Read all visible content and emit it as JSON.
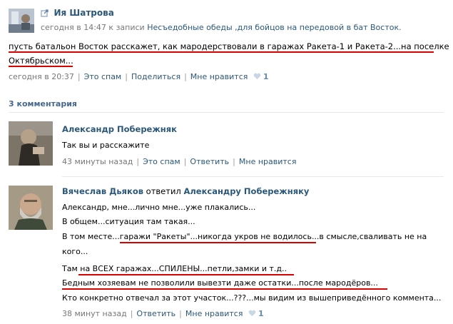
{
  "post": {
    "author": "Ия Шатрова",
    "meta_time": "сегодня в 14:47",
    "meta_mid": "к записи",
    "meta_link": "Несъедобные обеды ,для бойцов на передовой в бат Восток.",
    "text_line1": "пусть батальон Восток расскажет, как мародерствовали в гаражах Ракета-1 и Ракета-2...на поселке",
    "text_line2": "Октябрьском...",
    "footer": {
      "time": "сегодня в 20:37",
      "spam": "Это спам",
      "share": "Поделиться",
      "like": "Мне нравится",
      "like_count": "1"
    }
  },
  "comments_header": "3 комментария",
  "comments": [
    {
      "author": "Александр Побережняк",
      "text": "Так вы и расскажите",
      "time": "43 минуты назад",
      "spam": "Это спам",
      "reply": "Ответить",
      "like": "Мне нравится"
    },
    {
      "author": "Вячеслав Дьяков",
      "replied": "ответил",
      "reply_to": "Александру Побережняку",
      "lines": [
        "Александр, мне...лично мне...уже плакались...",
        "В общем...ситуация там такая...",
        "В том месте...гаражи \"Ракеты\"...никогда укров не водилось...в смысле,сваливать не на",
        "кого...",
        "Там на ВСЕХ гаражах...СПИЛЕНЫ...петли,замки и т.д..",
        "Бедным хозяевам не позволили вывезти даже остатки...после мародёров...",
        "Кто конкретно отвечал за этот участок...???...мы видим из вышеприведённого коммента..."
      ],
      "time": "38 минут назад",
      "reply": "Ответить",
      "like": "Мне нравится",
      "like_count": "1"
    }
  ],
  "colors": {
    "link": "#2b587a",
    "meta": "#777777",
    "underline": "#d90000",
    "heart": "#c8d7e3"
  }
}
